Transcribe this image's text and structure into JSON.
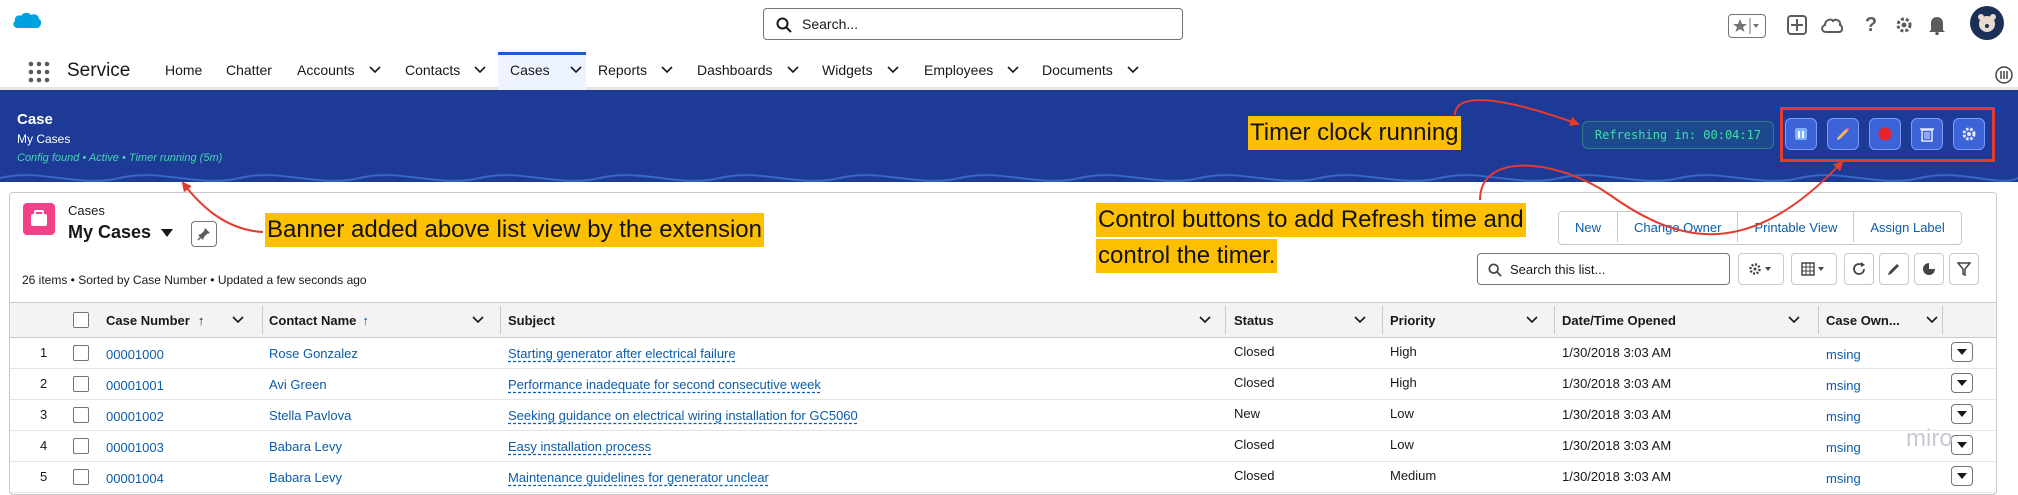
{
  "header": {
    "search_placeholder": "Search...",
    "icons": [
      "salesforce-cloud-icon",
      "favorites-star-icon",
      "add-icon",
      "setup-cloud-icon",
      "help-icon",
      "gear-icon",
      "bell-icon",
      "avatar"
    ]
  },
  "nav": {
    "app_name": "Service",
    "items": [
      {
        "label": "Home",
        "has_menu": false
      },
      {
        "label": "Chatter",
        "has_menu": false
      },
      {
        "label": "Accounts",
        "has_menu": true
      },
      {
        "label": "Contacts",
        "has_menu": true
      },
      {
        "label": "Cases",
        "has_menu": true,
        "active": true
      },
      {
        "label": "Reports",
        "has_menu": true
      },
      {
        "label": "Dashboards",
        "has_menu": true
      },
      {
        "label": "Widgets",
        "has_menu": true
      },
      {
        "label": "Employees",
        "has_menu": true
      },
      {
        "label": "Documents",
        "has_menu": true
      }
    ]
  },
  "banner": {
    "title": "Case",
    "subtitle": "My Cases",
    "status": "Config found • Active • Timer running (5m)",
    "timer": "Refreshing in: 00:04:17",
    "controls": [
      "pause-icon",
      "pencil-icon",
      "record-icon",
      "trash-icon",
      "gear-icon"
    ]
  },
  "listview": {
    "object_label": "Cases",
    "name": "My Cases",
    "meta": "26 items • Sorted by Case Number • Updated a few seconds ago",
    "actions": [
      "New",
      "Change Owner",
      "Printable View",
      "Assign Label"
    ],
    "search_placeholder": "Search this list..."
  },
  "table": {
    "columns": [
      "Case Number",
      "Contact Name",
      "Subject",
      "Status",
      "Priority",
      "Date/Time Opened",
      "Case Own..."
    ],
    "rows": [
      {
        "num": "1",
        "case": "00001000",
        "contact": "Rose Gonzalez",
        "subject": "Starting generator after electrical failure",
        "status": "Closed",
        "priority": "High",
        "opened": "1/30/2018 3:03 AM",
        "owner": "msing"
      },
      {
        "num": "2",
        "case": "00001001",
        "contact": "Avi Green",
        "subject": "Performance inadequate for second consecutive week",
        "status": "Closed",
        "priority": "High",
        "opened": "1/30/2018 3:03 AM",
        "owner": "msing"
      },
      {
        "num": "3",
        "case": "00001002",
        "contact": "Stella Pavlova",
        "subject": "Seeking guidance on electrical wiring installation for GC5060",
        "status": "New",
        "priority": "Low",
        "opened": "1/30/2018 3:03 AM",
        "owner": "msing"
      },
      {
        "num": "4",
        "case": "00001003",
        "contact": "Babara Levy",
        "subject": "Easy installation process",
        "status": "Closed",
        "priority": "Low",
        "opened": "1/30/2018 3:03 AM",
        "owner": "msing"
      },
      {
        "num": "5",
        "case": "00001004",
        "contact": "Babara Levy",
        "subject": "Maintenance guidelines for generator unclear",
        "status": "Closed",
        "priority": "Medium",
        "opened": "1/30/2018 3:03 AM",
        "owner": "msing"
      }
    ]
  },
  "annotations": {
    "timer": "Timer clock running",
    "banner": "Banner added above list view by the extension",
    "controls_line1": "Control buttons to add Refresh time and",
    "controls_line2": "control the timer.",
    "color": "#fdc000"
  },
  "watermark": "miro"
}
